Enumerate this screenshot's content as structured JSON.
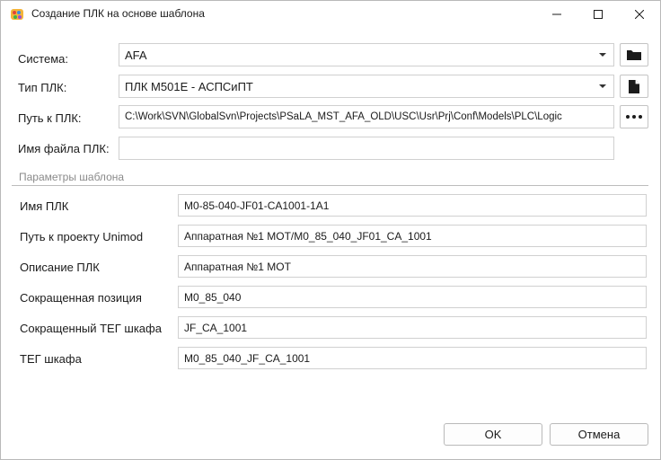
{
  "window": {
    "title": "Создание ПЛК на основе шаблона",
    "icon": "app-palette-icon"
  },
  "form": {
    "system_label": "Система:",
    "system_value": "AFA",
    "plc_type_label": "Тип ПЛК:",
    "plc_type_value": "ПЛК M501E - АСПСиПТ",
    "plc_path_label": "Путь к ПЛК:",
    "plc_path_value": "C:\\Work\\SVN\\GlobalSvn\\Projects\\PSaLA_MST_AFA_OLD\\USC\\Usr\\Prj\\Conf\\Models\\PLC\\Logic",
    "plc_filename_label": "Имя файла ПЛК:",
    "plc_filename_value": ""
  },
  "buttons": {
    "browse_folder_icon": "folder-icon",
    "new_file_icon": "file-icon",
    "more_icon": "ellipsis-icon",
    "ok_label": "OK",
    "cancel_label": "Отмена"
  },
  "template_params": {
    "section_title": "Параметры шаблона",
    "rows": [
      {
        "label": "Имя ПЛК",
        "value": "M0-85-040-JF01-CA1001-1A1"
      },
      {
        "label": "Путь к проекту Unimod",
        "value": "Аппаратная №1 МОТ/M0_85_040_JF01_CA_1001"
      },
      {
        "label": "Описание ПЛК",
        "value": "Аппаратная №1 МОТ"
      },
      {
        "label": "Сокращенная позиция",
        "value": "M0_85_040"
      },
      {
        "label": "Сокращенный ТЕГ шкафа",
        "value": "JF_CA_1001"
      },
      {
        "label": "ТЕГ шкафа",
        "value": "M0_85_040_JF_CA_1001"
      }
    ]
  }
}
